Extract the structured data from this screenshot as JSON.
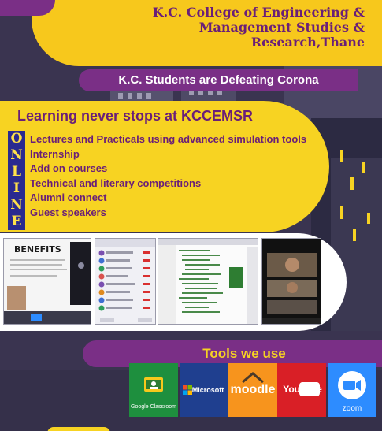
{
  "header": {
    "college_name": "K.C. College of Engineering &\nManagement Studies &\nResearch,Thane",
    "slogan": "K.C. Students are Defeating Corona"
  },
  "learning": {
    "title": "Learning never stops at KCCEMSR",
    "online_letters": [
      "O",
      "N",
      "L",
      "I",
      "N",
      "E"
    ],
    "items": [
      "Lectures and Practicals using advanced simulation tools",
      "Internship",
      "Add on courses",
      "Technical and literary competitions",
      "Alumni connect",
      "Guest speakers"
    ]
  },
  "screenshots": {
    "benefits_title": "BENEFITS"
  },
  "tools": {
    "title": "Tools we use",
    "items": [
      {
        "label": "Google Classroom",
        "icon": "google-classroom-icon",
        "bg": "#1e8f3e"
      },
      {
        "label": "Microsoft",
        "icon": "microsoft-icon",
        "bg": "#1f3f8f"
      },
      {
        "label": "moodle",
        "icon": "moodle-icon",
        "bg": "#f7941d"
      },
      {
        "label": "YouTube",
        "icon": "youtube-icon",
        "bg": "#d91f26"
      },
      {
        "label": "zoom",
        "icon": "zoom-icon",
        "bg": "#2d8cff"
      }
    ]
  },
  "colors": {
    "yellow": "#f7d322",
    "purple": "#7a2f86",
    "dark": "#3a3450"
  }
}
